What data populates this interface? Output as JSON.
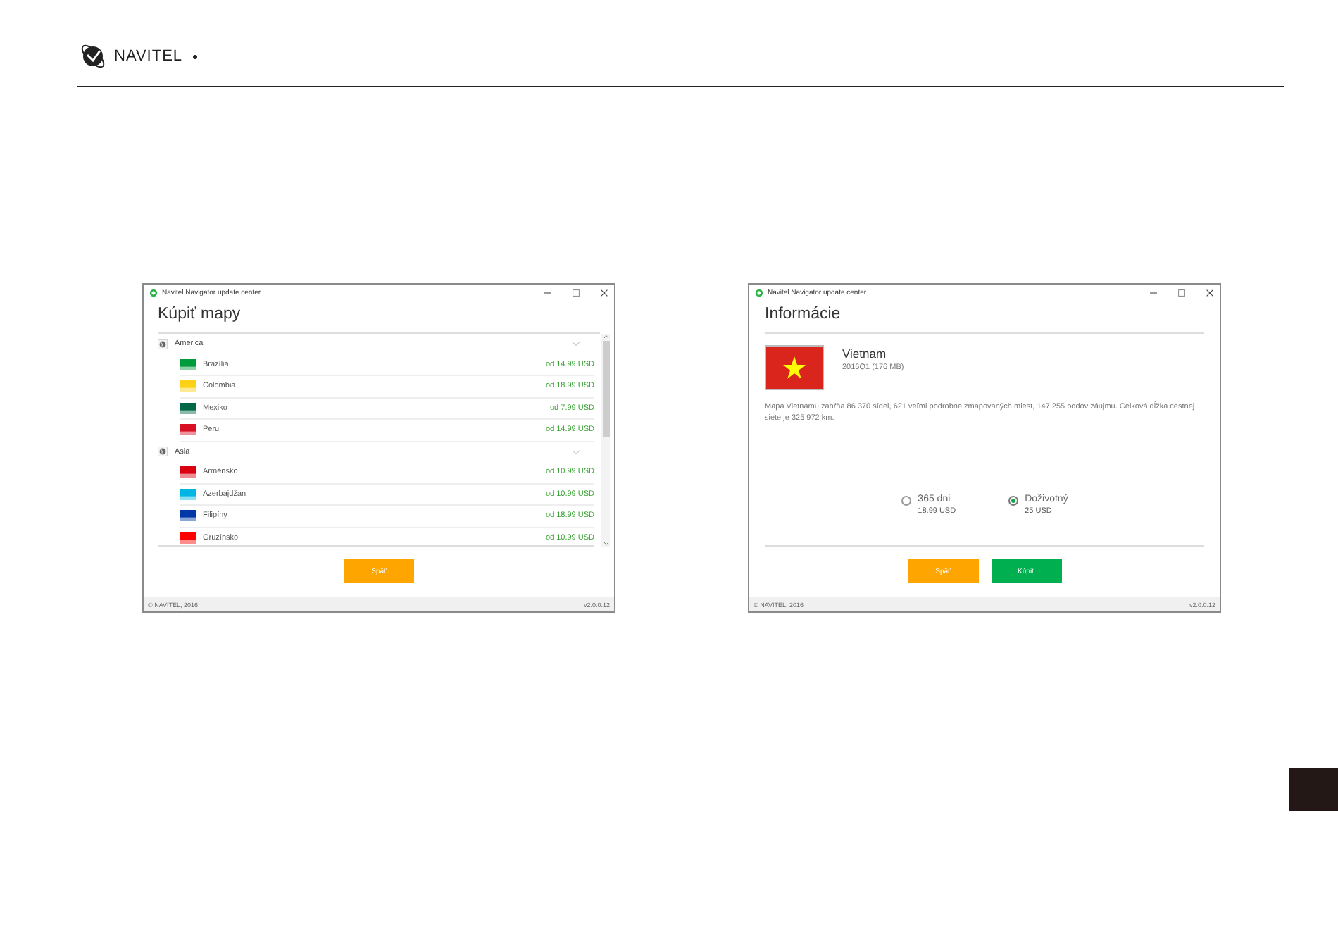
{
  "brand": {
    "name": "NAVITEL"
  },
  "buy_window": {
    "title": "Navitel Navigator update center",
    "heading": "Kúpiť mapy",
    "groups": [
      {
        "name": "America",
        "expanded": true,
        "items": [
          {
            "name": "Brazília",
            "price": "od 14.99 USD",
            "color": "#009c3b"
          },
          {
            "name": "Colombia",
            "price": "od 18.99 USD",
            "color": "#fcd116"
          },
          {
            "name": "Mexiko",
            "price": "od 7.99 USD",
            "color": "#006847"
          },
          {
            "name": "Peru",
            "price": "od 14.99 USD",
            "color": "#d91023"
          }
        ]
      },
      {
        "name": "Asia",
        "expanded": true,
        "items": [
          {
            "name": "Arménsko",
            "price": "od 10.99 USD",
            "color": "#d90012"
          },
          {
            "name": "Azerbajdžan",
            "price": "od 10.99 USD",
            "color": "#00b5e2"
          },
          {
            "name": "Filipíny",
            "price": "od 18.99 USD",
            "color": "#0038a8"
          },
          {
            "name": "Gruzínsko",
            "price": "od 10.99 USD",
            "color": "#ff0000"
          }
        ]
      }
    ],
    "buttons": [
      {
        "label": "Späť",
        "kind": "back"
      }
    ],
    "copyright": "© NAVITEL, 2016",
    "version": "v2.0.0.12"
  },
  "info_window": {
    "title": "Navitel Navigator update center",
    "heading": "Informácie",
    "map_name": "Vietnam",
    "map_version": "2016Q1 (176 MB)",
    "description": "Mapa Vietnamu zahŕňa 86 370 sídel, 621 veľmi podrobne zmapovaných miest, 147 255 bodov záujmu. Celková dĺžka cestnej siete je 325 972 km.",
    "options": [
      {
        "label": "365 dni",
        "price": "18.99 USD",
        "selected": false
      },
      {
        "label": "Doživotný",
        "price": "25 USD",
        "selected": true
      }
    ],
    "buttons": [
      {
        "label": "Späť",
        "kind": "back"
      },
      {
        "label": "Kúpiť",
        "kind": "buy"
      }
    ],
    "copyright": "© NAVITEL, 2016",
    "version": "v2.0.0.12"
  }
}
